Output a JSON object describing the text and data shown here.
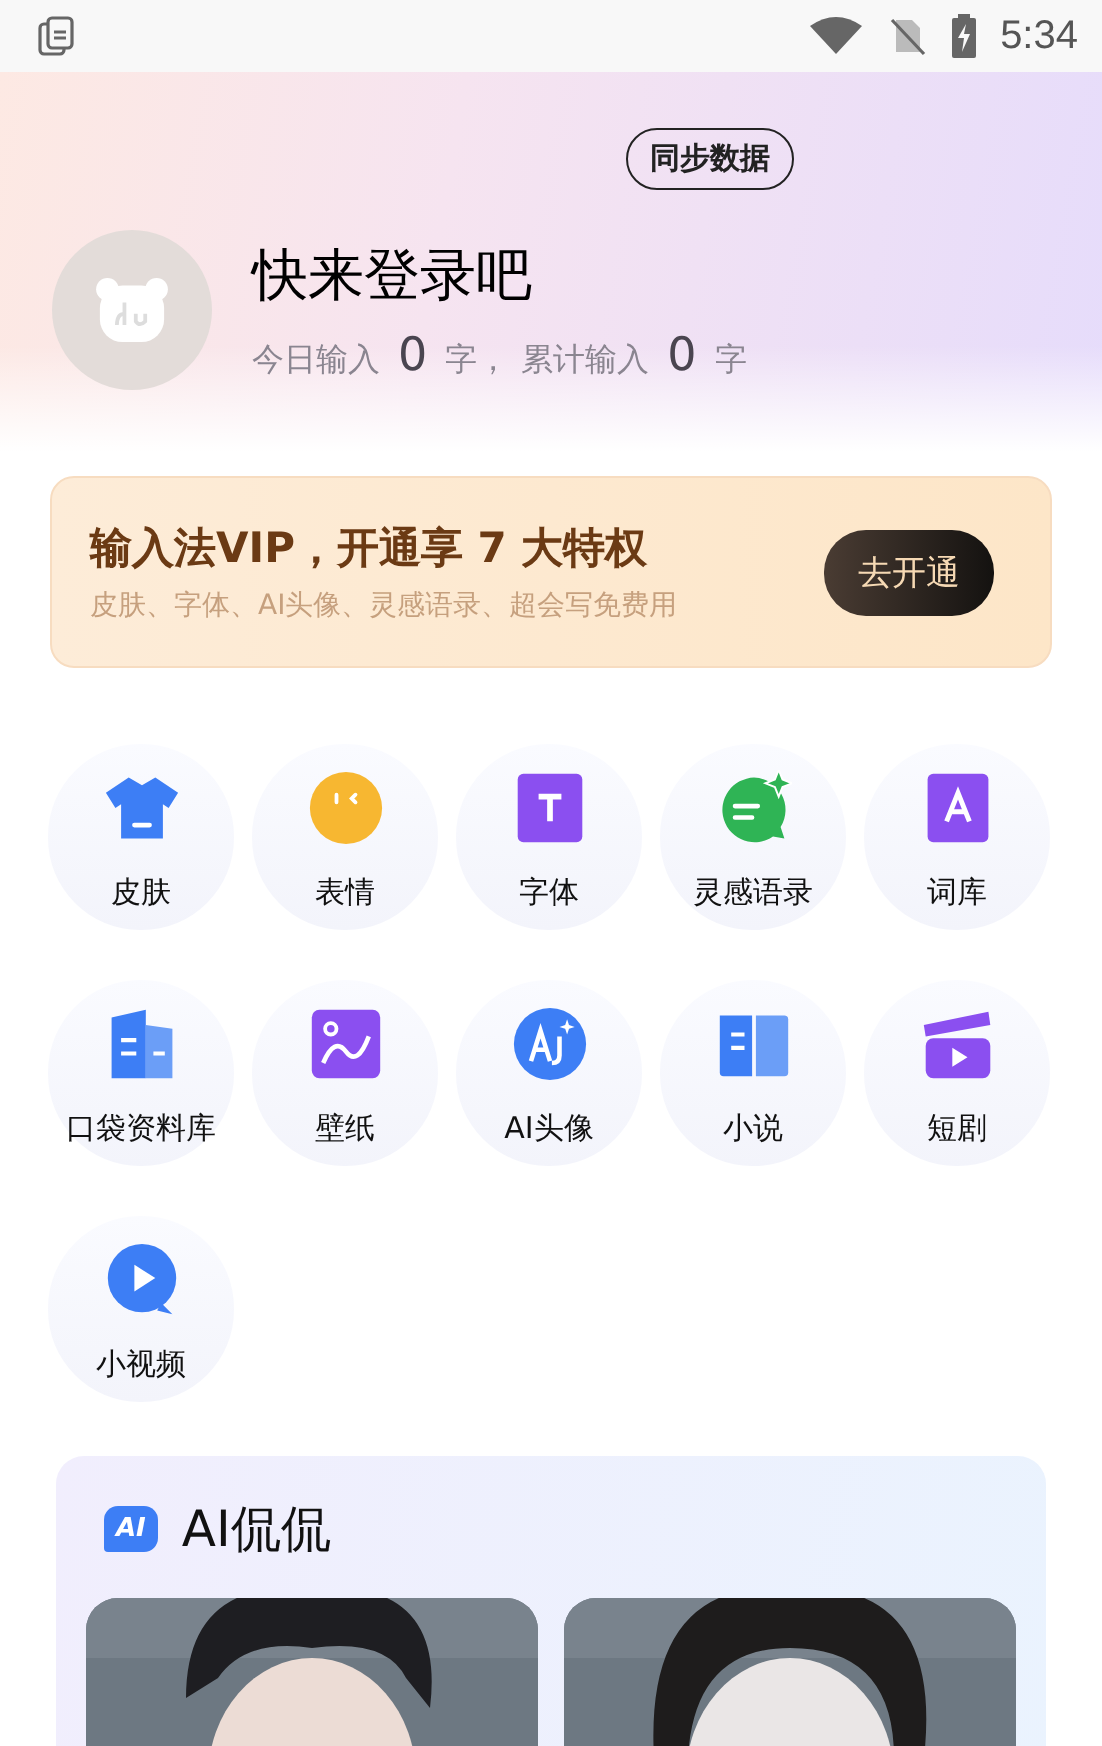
{
  "status_bar": {
    "time": "5:34"
  },
  "profile": {
    "sync_button": "同步数据",
    "title": "快来登录吧",
    "stats": [
      {
        "label": "今日输入",
        "value": "0",
        "unit": "字，"
      },
      {
        "label": "累计输入",
        "value": "0",
        "unit": "字"
      }
    ]
  },
  "vip_banner": {
    "title": "输入法VIP，开通享 7 大特权",
    "subtitle": "皮肤、字体、AI头像、灵感语录、超会写免费用",
    "button": "去开通"
  },
  "features": [
    {
      "label": "皮肤",
      "kind": "shirt"
    },
    {
      "label": "表情",
      "kind": "face"
    },
    {
      "label": "字体",
      "kind": "font"
    },
    {
      "label": "灵感语录",
      "kind": "chat"
    },
    {
      "label": "词库",
      "kind": "lexicon"
    },
    {
      "label": "口袋资料库",
      "kind": "folder"
    },
    {
      "label": "壁纸",
      "kind": "wallpaper"
    },
    {
      "label": "AI头像",
      "kind": "avatar"
    },
    {
      "label": "小说",
      "kind": "book"
    },
    {
      "label": "短剧",
      "kind": "clapper"
    },
    {
      "label": "小视频",
      "kind": "video"
    }
  ],
  "ai_chat": {
    "title": "AI侃侃",
    "badge": "AI"
  }
}
